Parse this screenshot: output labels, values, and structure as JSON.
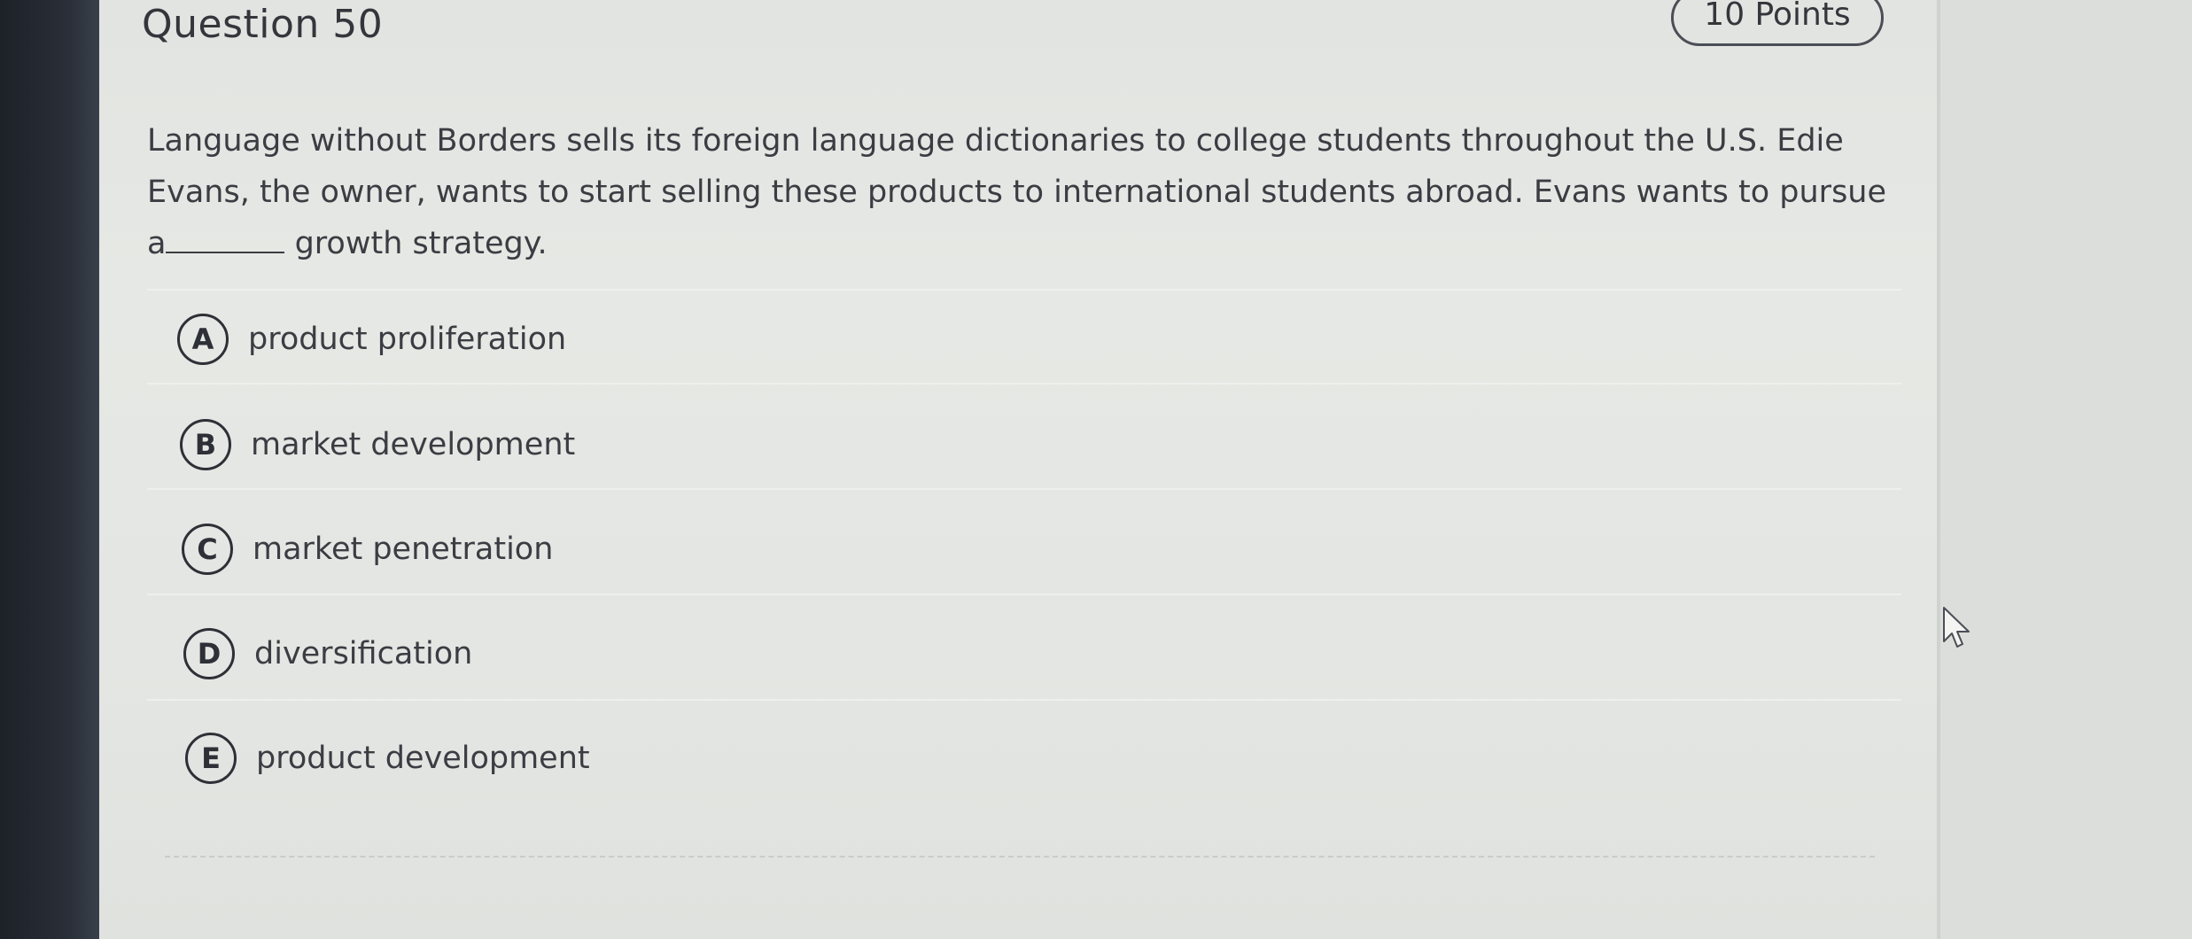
{
  "question": {
    "title": "Question 50",
    "points": "10 Points",
    "text_before_blank": "Language without Borders sells its foreign language dictionaries to college students throughout the U.S. Edie Evans, the owner, wants to start selling these products to international students abroad. Evans wants to pursue a",
    "text_after_blank": "growth strategy."
  },
  "options": [
    {
      "letter": "A",
      "label": "product proliferation"
    },
    {
      "letter": "B",
      "label": "market development"
    },
    {
      "letter": "C",
      "label": "market penetration"
    },
    {
      "letter": "D",
      "label": "diversification"
    },
    {
      "letter": "E",
      "label": "product development"
    }
  ],
  "icons": {
    "cursor": "mouse-pointer-icon"
  },
  "colors": {
    "text": "#3a3d42",
    "card_background": "#e6e8e5",
    "sidebar": "#1d2128"
  }
}
